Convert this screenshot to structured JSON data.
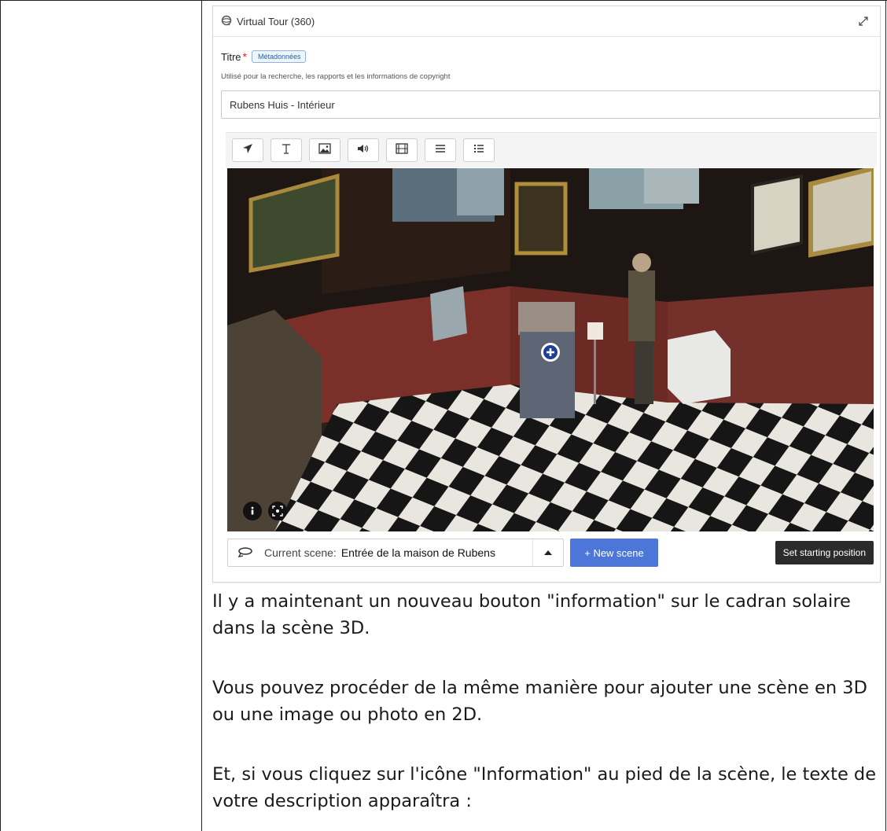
{
  "widget": {
    "header_title": "Virtual Tour (360)",
    "field_label": "Titre",
    "required_mark": "*",
    "meta_badge": "Métadonnées",
    "help_text": "Utilisé pour la recherche, les rapports et les informations de copyright",
    "title_value": "Rubens Huis - Intérieur",
    "toolbar_icons": [
      "navigate-icon",
      "text-icon",
      "image-icon",
      "audio-icon",
      "video-icon",
      "list-icon",
      "numbered-list-icon"
    ],
    "scene_label": "Current scene:",
    "scene_value": "Entrée de la maison de Rubens",
    "new_scene_label": "+ New scene",
    "start_position_label": "Set starting position",
    "accent_color": "#4c76d8"
  },
  "document": {
    "paragraph1": "Il y a maintenant un nouveau bouton \"information\" sur le cadran solaire dans la scène 3D.",
    "paragraph2": "Vous pouvez procéder de la même manière pour ajouter une scène en 3D ou une image ou photo en 2D.",
    "paragraph3": "Et, si vous cliquez sur l'icône \"Information\" au pied de la scène, le texte de votre description apparaîtra :"
  }
}
